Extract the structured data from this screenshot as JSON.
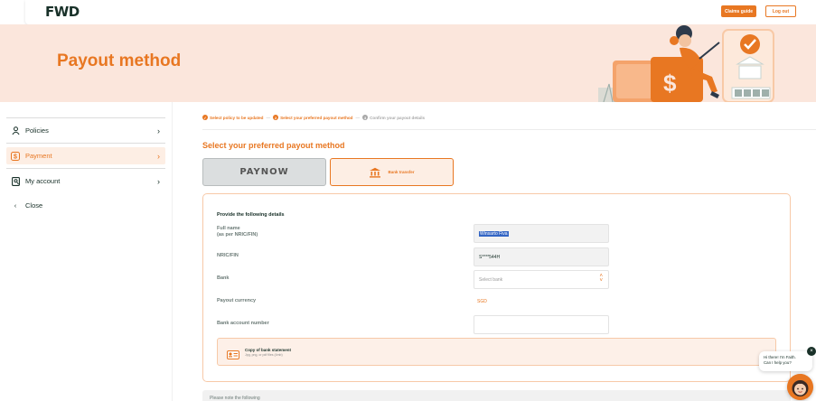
{
  "header": {
    "logo": "FWD",
    "claims_guide_label": "Claims guide",
    "logout_label": "Log out"
  },
  "hero": {
    "title": "Payout method"
  },
  "sidebar": {
    "items": [
      {
        "label": "Policies",
        "icon": "user-icon"
      },
      {
        "label": "Payment",
        "icon": "dollar-icon"
      },
      {
        "label": "My account",
        "icon": "document-icon"
      },
      {
        "label": "Close",
        "icon": "chevron-left-icon"
      }
    ]
  },
  "stepper": {
    "steps": [
      {
        "label": "Select policy to be updated",
        "status": "done"
      },
      {
        "label": "Select your preferred payout method",
        "status": "current"
      },
      {
        "label": "Confirm your payout details",
        "status": "pending"
      }
    ]
  },
  "main": {
    "section_title": "Select your preferred payout method",
    "methods": [
      {
        "label": "PAYNOW"
      },
      {
        "label": "Bank transfer"
      }
    ]
  },
  "form": {
    "heading": "Provide the following details",
    "full_name_label_1": "Full name",
    "full_name_label_2": "(as per NRIC/FIN)",
    "full_name_value": "Winsarto Fiva",
    "nric_label": "NRIC/FIN",
    "nric_value": "S****544H",
    "bank_label": "Bank",
    "bank_placeholder": "Select bank",
    "currency_label": "Payout currency",
    "currency_value": "SGD",
    "account_label": "Bank account number",
    "upload_title": "Copy of bank statement",
    "upload_hint": "Jpg, png, or pdf files (4mb)"
  },
  "next_section": {
    "label": "Please note the following"
  },
  "chat": {
    "line1": "Hi there! I'm Faith.",
    "line2": "Can I help you?"
  },
  "colors": {
    "accent": "#e87722",
    "hero_bg": "#fbe6dc",
    "text_dark": "#183028"
  }
}
